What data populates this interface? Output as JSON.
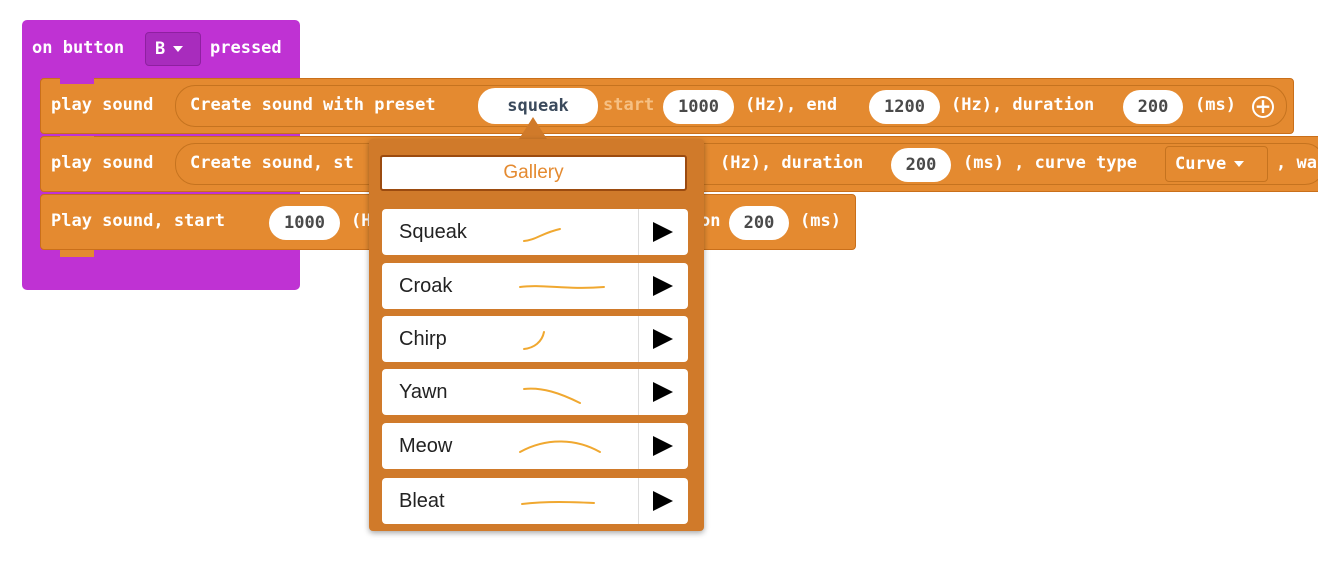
{
  "event_block": {
    "prefix": "on button",
    "button": "B",
    "suffix": "pressed"
  },
  "row1": {
    "play": "play sound",
    "create": "Create sound with preset",
    "preset": "squeak",
    "start": "start",
    "start_value": "1000",
    "hz1": "(Hz), end",
    "end_value": "1200",
    "hz2": "(Hz), duration",
    "duration_value": "200",
    "ms": "(ms)"
  },
  "row2": {
    "play": "play sound",
    "create": "Create sound, st",
    "hz": "(Hz), duration",
    "duration_value": "200",
    "ms": "(ms) , curve type",
    "curve_type": "Curve",
    "tail": ", wa"
  },
  "row3": {
    "text": "Play sound, start",
    "start_value": "1000",
    "hz_partial": "(H",
    "on_partial": "on",
    "duration_value": "200",
    "ms": "(ms)"
  },
  "gallery": {
    "title": "Gallery",
    "items": [
      {
        "label": "Squeak",
        "curve_icon": "squeak-curve-icon"
      },
      {
        "label": "Croak",
        "curve_icon": "croak-curve-icon"
      },
      {
        "label": "Chirp",
        "curve_icon": "chirp-curve-icon"
      },
      {
        "label": "Yawn",
        "curve_icon": "yawn-curve-icon"
      },
      {
        "label": "Meow",
        "curve_icon": "meow-curve-icon"
      },
      {
        "label": "Bleat",
        "curve_icon": "bleat-curve-icon"
      }
    ]
  },
  "colors": {
    "event_purple": "#bf32d3",
    "block_orange": "#e48a30",
    "popup_orange": "#d07a2a",
    "curve_stroke": "#f0a830"
  }
}
